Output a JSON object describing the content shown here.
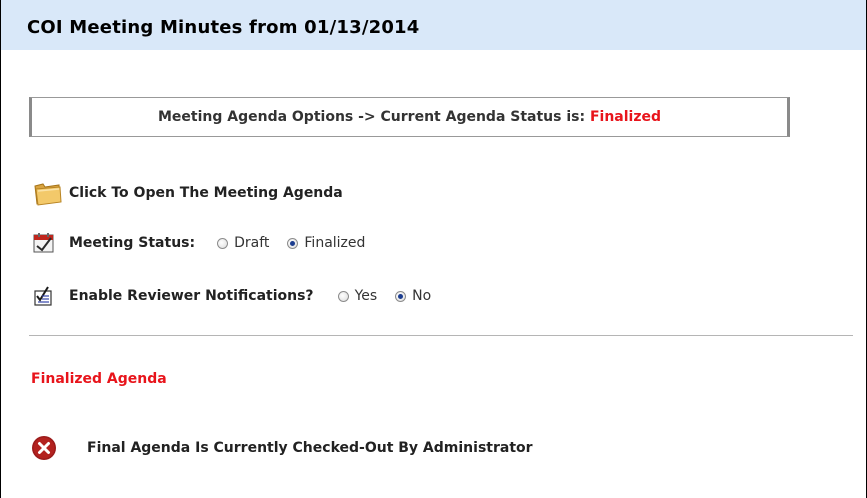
{
  "header": {
    "title": "COI Meeting Minutes from 01/13/2014"
  },
  "agenda_options": {
    "prefix": "Meeting Agenda Options -> Current Agenda Status is: ",
    "status": "Finalized",
    "status_color": "#e8141b"
  },
  "open_agenda": {
    "label": "Click To Open The Meeting Agenda",
    "icon": "folder-icon"
  },
  "meeting_status": {
    "label": "Meeting Status:",
    "icon": "calendar-icon",
    "options": [
      {
        "label": "Draft",
        "checked": false
      },
      {
        "label": "Finalized",
        "checked": true
      }
    ]
  },
  "reviewer_notifications": {
    "label": "Enable Reviewer Notifications?",
    "icon": "checklist-icon",
    "options": [
      {
        "label": "Yes",
        "checked": false
      },
      {
        "label": "No",
        "checked": true
      }
    ]
  },
  "finalized_section": {
    "title": "Finalized Agenda",
    "title_color": "#e8141b"
  },
  "checkout_status": {
    "message": "Final Agenda Is Currently Checked-Out By Administrator",
    "icon": "error-x-icon"
  },
  "colors": {
    "header_bg": "#d9e8f9"
  }
}
